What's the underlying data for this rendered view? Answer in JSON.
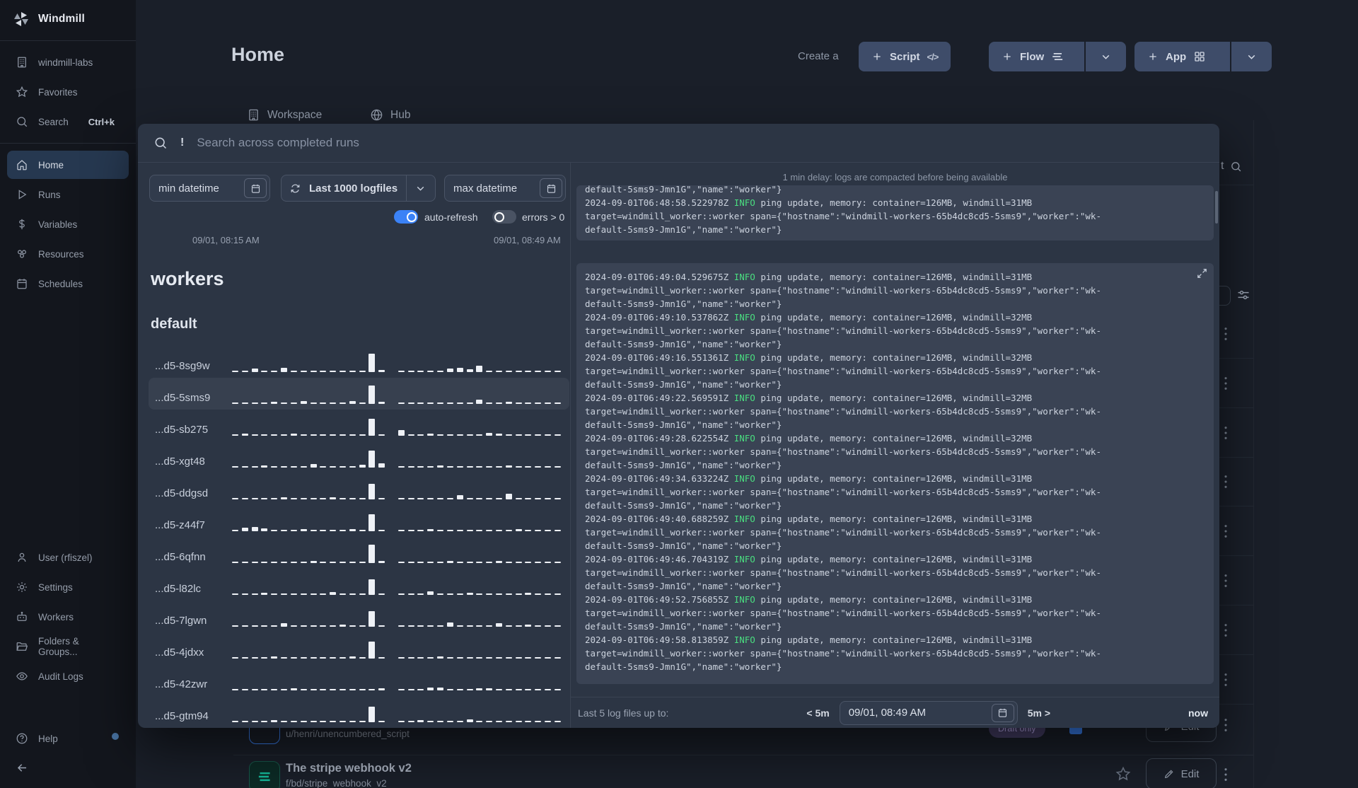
{
  "colors": {
    "accent_blue": "#3b82f6",
    "info_green": "#4ade80",
    "badge_purple": "#474068",
    "flow_teal": "#15b899",
    "button_slate": "#3e4c69"
  },
  "sidebar": {
    "brand": "Windmill",
    "items_top": [
      {
        "icon": "building",
        "label": "windmill-labs"
      },
      {
        "icon": "star",
        "label": "Favorites"
      },
      {
        "icon": "search",
        "label": "Search",
        "shortcut": "Ctrl+k"
      }
    ],
    "items_nav": [
      {
        "icon": "home",
        "label": "Home",
        "active": true
      },
      {
        "icon": "play",
        "label": "Runs"
      },
      {
        "icon": "dollar",
        "label": "Variables"
      },
      {
        "icon": "boxes",
        "label": "Resources"
      },
      {
        "icon": "calendar",
        "label": "Schedules"
      }
    ],
    "items_bottom": [
      {
        "icon": "user",
        "label": "User (rfiszel)"
      },
      {
        "icon": "gear",
        "label": "Settings"
      },
      {
        "icon": "robot",
        "label": "Workers"
      },
      {
        "icon": "folder",
        "label": "Folders & Groups..."
      },
      {
        "icon": "eye",
        "label": "Audit Logs"
      }
    ],
    "help_label": "Help"
  },
  "header": {
    "title": "Home",
    "create_label": "Create a",
    "script_label": "Script",
    "flow_label": "Flow",
    "app_label": "App"
  },
  "tabs": {
    "workspace": "Workspace",
    "hub": "Hub"
  },
  "background": {
    "kebab_rows": 8,
    "search_fragment": "t",
    "row1": {
      "path": "u/henri/unencumbered_script",
      "badge": "Draft only",
      "edit_label": "Edit"
    },
    "row2": {
      "title": "The stripe webhook v2",
      "path": "f/bd/stripe_webhook_v2",
      "edit_label": "Edit"
    }
  },
  "modal": {
    "search_prefix": "!",
    "search_placeholder": "Search across completed runs",
    "filters": {
      "min_placeholder": "min datetime",
      "logfiles": "Last 1000 logfiles",
      "max_placeholder": "max datetime"
    },
    "toggles": [
      {
        "label": "auto-refresh",
        "on": true
      },
      {
        "label": "errors > 0",
        "on": false
      }
    ],
    "range": {
      "start": "09/01, 08:15 AM",
      "end": "09/01, 08:49 AM"
    },
    "workers_title": "workers",
    "group_title": "default",
    "selected_worker": 1,
    "workers": [
      {
        "name": "...d5-8sg9w",
        "bars": [
          2,
          2,
          5,
          2,
          2,
          6,
          2,
          2,
          2,
          2,
          2,
          2,
          2,
          2,
          26,
          3,
          0,
          2,
          2,
          2,
          2,
          2,
          5,
          6,
          4,
          9,
          2,
          2,
          2,
          2,
          2,
          2,
          2,
          2
        ]
      },
      {
        "name": "...d5-5sms9",
        "bars": [
          2,
          2,
          2,
          2,
          3,
          2,
          2,
          4,
          2,
          2,
          2,
          2,
          4,
          2,
          26,
          3,
          0,
          2,
          2,
          2,
          2,
          2,
          2,
          2,
          2,
          6,
          2,
          2,
          3,
          2,
          2,
          2,
          2,
          2
        ]
      },
      {
        "name": "...d5-sb275",
        "bars": [
          2,
          3,
          2,
          2,
          2,
          2,
          3,
          2,
          2,
          2,
          2,
          2,
          2,
          2,
          24,
          2,
          0,
          8,
          2,
          2,
          3,
          2,
          2,
          2,
          2,
          2,
          4,
          3,
          2,
          2,
          2,
          2,
          2,
          2
        ]
      },
      {
        "name": "...d5-xgt48",
        "bars": [
          2,
          2,
          2,
          3,
          2,
          2,
          2,
          2,
          5,
          2,
          2,
          2,
          2,
          4,
          24,
          6,
          0,
          2,
          2,
          2,
          2,
          3,
          2,
          2,
          2,
          2,
          2,
          2,
          3,
          2,
          2,
          2,
          2,
          2
        ]
      },
      {
        "name": "...d5-ddgsd",
        "bars": [
          2,
          2,
          2,
          2,
          2,
          3,
          2,
          2,
          2,
          2,
          3,
          2,
          2,
          2,
          22,
          2,
          0,
          2,
          2,
          2,
          2,
          2,
          2,
          6,
          2,
          2,
          2,
          2,
          8,
          2,
          2,
          2,
          2,
          2
        ]
      },
      {
        "name": "...d5-z44f7",
        "bars": [
          2,
          5,
          6,
          4,
          2,
          2,
          2,
          3,
          2,
          2,
          2,
          2,
          3,
          2,
          24,
          2,
          0,
          2,
          2,
          2,
          3,
          2,
          2,
          2,
          2,
          2,
          2,
          2,
          2,
          3,
          2,
          2,
          2,
          2
        ]
      },
      {
        "name": "...d5-6qfnn",
        "bars": [
          2,
          2,
          2,
          2,
          2,
          2,
          2,
          2,
          3,
          2,
          2,
          2,
          2,
          2,
          26,
          3,
          0,
          2,
          2,
          2,
          2,
          2,
          3,
          2,
          2,
          2,
          2,
          3,
          2,
          2,
          2,
          2,
          2,
          2
        ]
      },
      {
        "name": "...d5-l82lc",
        "bars": [
          2,
          2,
          2,
          3,
          2,
          2,
          2,
          2,
          2,
          2,
          4,
          2,
          2,
          2,
          22,
          2,
          0,
          2,
          2,
          2,
          5,
          2,
          2,
          2,
          3,
          2,
          2,
          2,
          2,
          2,
          3,
          2,
          2,
          2
        ]
      },
      {
        "name": "...d5-7lgwn",
        "bars": [
          2,
          2,
          2,
          2,
          2,
          5,
          2,
          2,
          2,
          2,
          2,
          3,
          2,
          2,
          22,
          2,
          0,
          2,
          2,
          2,
          2,
          2,
          6,
          2,
          2,
          2,
          2,
          5,
          2,
          2,
          3,
          2,
          2,
          2
        ]
      },
      {
        "name": "...d5-4jdxx",
        "bars": [
          2,
          2,
          2,
          2,
          3,
          2,
          2,
          2,
          2,
          2,
          2,
          2,
          3,
          2,
          24,
          2,
          0,
          2,
          2,
          2,
          2,
          3,
          2,
          2,
          2,
          2,
          2,
          2,
          2,
          2,
          2,
          2,
          2,
          2
        ]
      },
      {
        "name": "...d5-42zwr",
        "bars": [
          2,
          2,
          2,
          2,
          2,
          2,
          3,
          2,
          2,
          2,
          2,
          2,
          2,
          2,
          2,
          3,
          0,
          2,
          2,
          2,
          4,
          4,
          2,
          2,
          2,
          3,
          3,
          2,
          2,
          2,
          2,
          2,
          2,
          2
        ]
      },
      {
        "name": "...d5-gtm94",
        "bars": [
          2,
          2,
          2,
          2,
          3,
          2,
          2,
          2,
          2,
          2,
          2,
          2,
          2,
          2,
          22,
          2,
          0,
          2,
          2,
          3,
          2,
          2,
          2,
          2,
          4,
          2,
          2,
          2,
          2,
          2,
          2,
          2,
          2,
          2
        ]
      }
    ],
    "logs": {
      "notice": "1 min delay: logs are compacted before being available",
      "clipped_line": "default-5sms9-Jmn1G\",\"name\":\"worker\"}",
      "level": "INFO",
      "msg_prefix": "ping update, memory: container=126MB, windmill=",
      "target_line1": "target=windmill_worker::worker span={\"hostname\":\"windmill-workers-65b4dc8cd5-5sms9\",\"worker\":\"wk-",
      "target_line2": "default-5sms9-Jmn1G\",\"name\":\"worker\"}",
      "prev_entry": {
        "ts": "2024-09-01T06:48:58.522978Z",
        "windmill": "31MB"
      },
      "section_header": "09/01, 08:49 AM",
      "entries": [
        {
          "ts": "2024-09-01T06:49:04.529675Z",
          "windmill": "31MB"
        },
        {
          "ts": "2024-09-01T06:49:10.537862Z",
          "windmill": "32MB"
        },
        {
          "ts": "2024-09-01T06:49:16.551361Z",
          "windmill": "32MB"
        },
        {
          "ts": "2024-09-01T06:49:22.569591Z",
          "windmill": "32MB"
        },
        {
          "ts": "2024-09-01T06:49:28.622554Z",
          "windmill": "32MB"
        },
        {
          "ts": "2024-09-01T06:49:34.633224Z",
          "windmill": "31MB"
        },
        {
          "ts": "2024-09-01T06:49:40.688259Z",
          "windmill": "31MB"
        },
        {
          "ts": "2024-09-01T06:49:46.704319Z",
          "windmill": "31MB"
        },
        {
          "ts": "2024-09-01T06:49:52.756855Z",
          "windmill": "31MB"
        },
        {
          "ts": "2024-09-01T06:49:58.813859Z",
          "windmill": "31MB"
        }
      ]
    },
    "footer": {
      "label": "Last 5 log files up to:",
      "back": "< 5m",
      "datetime": "09/01, 08:49 AM",
      "forward": "5m >",
      "now": "now"
    }
  }
}
